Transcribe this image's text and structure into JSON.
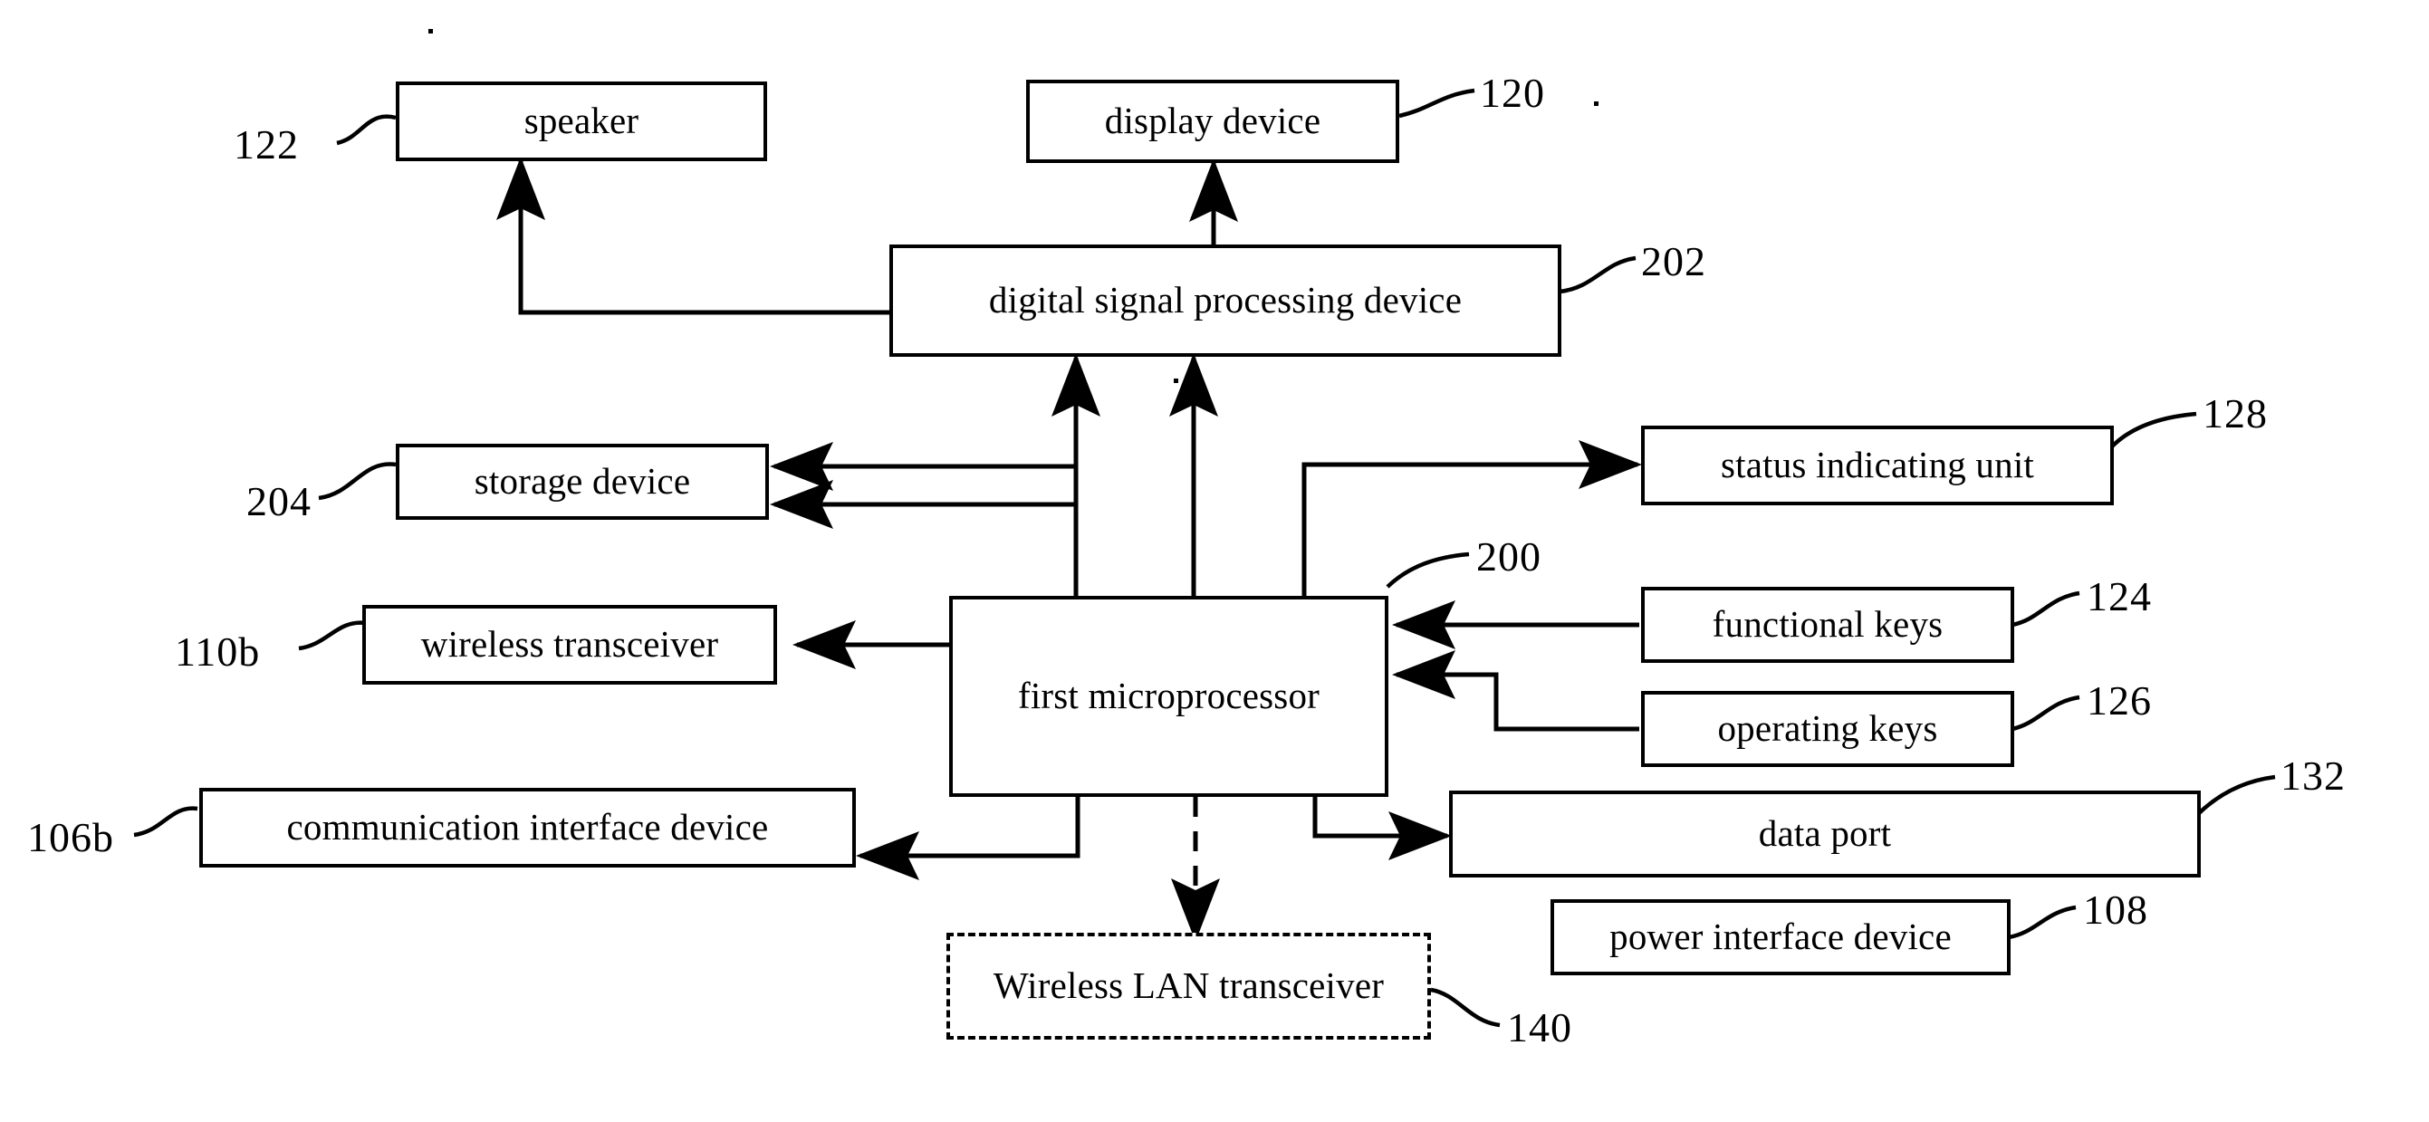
{
  "figure": {
    "type": "patent-block-diagram",
    "background_color": "#ffffff",
    "line_color": "#000000"
  },
  "blocks": [
    {
      "id": "speaker",
      "label": "speaker",
      "ref": "122",
      "dashed": false
    },
    {
      "id": "display",
      "label": "display device",
      "ref": "120",
      "dashed": false
    },
    {
      "id": "dsp",
      "label": "digital signal processing device",
      "ref": "202",
      "dashed": false
    },
    {
      "id": "storage",
      "label": "storage device",
      "ref": "204",
      "dashed": false
    },
    {
      "id": "status",
      "label": "status indicating unit",
      "ref": "128",
      "dashed": false
    },
    {
      "id": "wireless",
      "label": "wireless transceiver",
      "ref": "110b",
      "dashed": false
    },
    {
      "id": "micro",
      "label": "first microprocessor",
      "ref": "200",
      "dashed": false
    },
    {
      "id": "funckeys",
      "label": "functional keys",
      "ref": "124",
      "dashed": false
    },
    {
      "id": "opkeys",
      "label": "operating keys",
      "ref": "126",
      "dashed": false
    },
    {
      "id": "comm",
      "label": "communication interface device",
      "ref": "106b",
      "dashed": false
    },
    {
      "id": "dataport",
      "label": "data port",
      "ref": "132",
      "dashed": false
    },
    {
      "id": "power",
      "label": "power interface device",
      "ref": "108",
      "dashed": false
    },
    {
      "id": "wlan",
      "label": "Wireless LAN transceiver",
      "ref": "140",
      "dashed": true
    }
  ],
  "reference_numerals": {
    "speaker": "122",
    "display": "120",
    "dsp": "202",
    "storage": "204",
    "status": "128",
    "wireless": "110b",
    "micro": "200",
    "funckeys": "124",
    "opkeys": "126",
    "comm": "106b",
    "dataport": "132",
    "power": "108",
    "wlan": "140"
  },
  "connections": [
    {
      "from": "dsp",
      "to": "speaker",
      "style": "solid",
      "arrow": "single"
    },
    {
      "from": "dsp",
      "to": "display",
      "style": "solid",
      "arrow": "double"
    },
    {
      "from": "dsp",
      "to": "storage",
      "style": "solid",
      "arrow": "single"
    },
    {
      "from": "micro",
      "to": "storage",
      "style": "solid",
      "arrow": "single"
    },
    {
      "from": "micro",
      "to": "dsp",
      "style": "solid",
      "arrow": "double"
    },
    {
      "from": "micro",
      "to": "dsp",
      "style": "solid",
      "arrow": "double"
    },
    {
      "from": "micro",
      "to": "status",
      "style": "solid",
      "arrow": "single"
    },
    {
      "from": "micro",
      "to": "wireless",
      "style": "solid",
      "arrow": "single"
    },
    {
      "from": "funckeys",
      "to": "micro",
      "style": "solid",
      "arrow": "single"
    },
    {
      "from": "opkeys",
      "to": "micro",
      "style": "solid",
      "arrow": "single"
    },
    {
      "from": "micro",
      "to": "comm",
      "style": "solid",
      "arrow": "single"
    },
    {
      "from": "micro",
      "to": "dataport",
      "style": "solid",
      "arrow": "single"
    },
    {
      "from": "micro",
      "to": "wlan",
      "style": "dashed",
      "arrow": "double"
    }
  ]
}
